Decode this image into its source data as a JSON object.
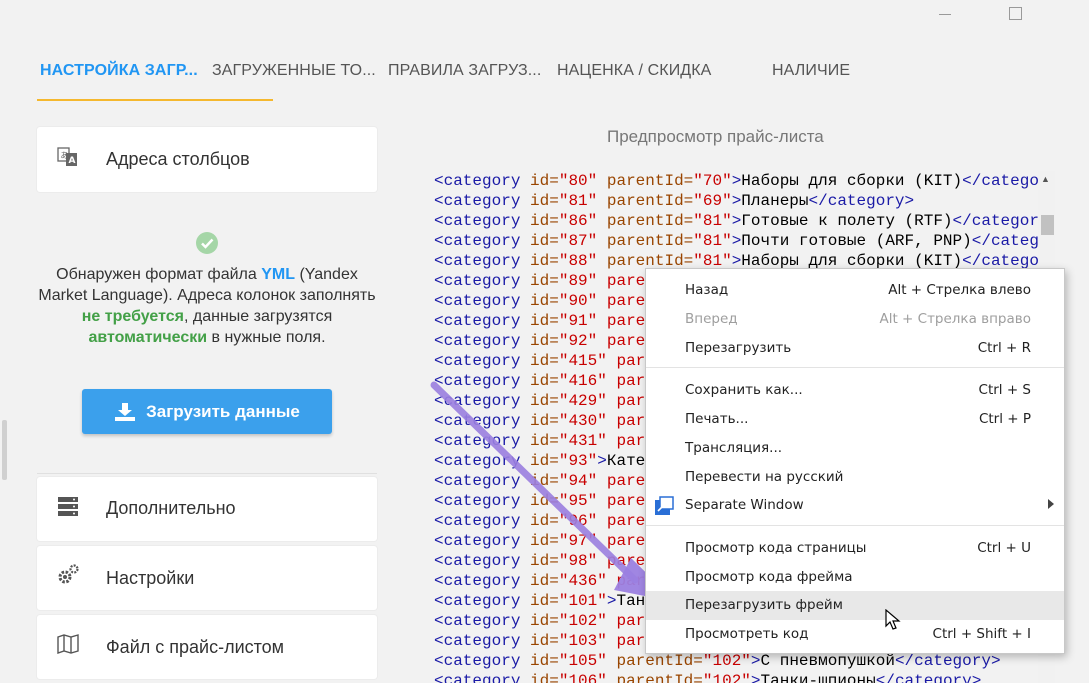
{
  "window": {
    "minimize_icon": "minimize-icon",
    "maximize_icon": "maximize-icon"
  },
  "tabs": [
    {
      "label": "НАСТРОЙКА ЗАГР...",
      "active": true
    },
    {
      "label": "ЗАГРУЖЕННЫЕ ТО..."
    },
    {
      "label": "ПРАВИЛА ЗАГРУЗ..."
    },
    {
      "label": "НАЦЕНКА / СКИДКА"
    },
    {
      "label": "НАЛИЧИЕ"
    }
  ],
  "sidebar": {
    "column_addresses": "Адреса столбцов",
    "info": {
      "p1": "Обнаружен формат файла ",
      "yml": "YML",
      "p2": " (Yandex Market Language). Адреса колонок заполнять ",
      "not_required": "не требуется",
      "p3": ", данные загрузятся ",
      "auto": "автоматически",
      "p4": " в нужные поля."
    },
    "upload_button": "Загрузить данные",
    "additional": "Дополнительно",
    "settings": "Настройки",
    "price_file": "Файл с прайс-листом"
  },
  "preview": {
    "title": "Предпросмотр прайс-листа",
    "lines": [
      {
        "id": "80",
        "parent": "70",
        "text": "Наборы для сборки (KIT)",
        "close": "</catego"
      },
      {
        "id": "81",
        "parent": "69",
        "text": "Планеры",
        "close": "</category>"
      },
      {
        "id": "86",
        "parent": "81",
        "text": "Готовые к полету (RTF)",
        "close": "</categor"
      },
      {
        "id": "87",
        "parent": "81",
        "text": "Почти готовые (ARF, PNP)",
        "close": "</categ"
      },
      {
        "id": "88",
        "parent": "81",
        "text": "Наборы для сборки (KIT)",
        "close": "</catego"
      },
      {
        "id": "89",
        "partial": "pare"
      },
      {
        "id": "90",
        "partial": "pare"
      },
      {
        "id": "91",
        "partial": "pare"
      },
      {
        "id": "92",
        "partial": "pare"
      },
      {
        "id": "415",
        "partial": "par"
      },
      {
        "id": "416",
        "partial": "par"
      },
      {
        "id": "429",
        "partial": "par"
      },
      {
        "id": "430",
        "partial": "par"
      },
      {
        "id": "431",
        "partial": "par"
      },
      {
        "id": "93",
        "plain": "Кате"
      },
      {
        "id": "94",
        "partial": "pare"
      },
      {
        "id": "95",
        "partial": "pare"
      },
      {
        "id": "96",
        "partial": "pare"
      },
      {
        "id": "97",
        "partial": "pare"
      },
      {
        "id": "98",
        "partial": "pare"
      },
      {
        "id": "436",
        "partial": "par"
      },
      {
        "id": "101",
        "plain": "Тан"
      },
      {
        "id": "102",
        "partial": "par"
      },
      {
        "id": "103",
        "partial": "par"
      },
      {
        "id": "105",
        "parent": "102",
        "text": "С пневмопушкой",
        "close": "</category>"
      },
      {
        "id": "106",
        "parent": "102",
        "text": "Танки-шпионы",
        "close": "</category>"
      }
    ]
  },
  "context_menu": {
    "items": [
      {
        "label": "Назад",
        "shortcut": "Alt + Стрелка влево"
      },
      {
        "label": "Вперед",
        "shortcut": "Alt + Стрелка вправо",
        "disabled": true
      },
      {
        "label": "Перезагрузить",
        "shortcut": "Ctrl + R"
      },
      {
        "label": "Сохранить как...",
        "shortcut": "Ctrl + S"
      },
      {
        "label": "Печать...",
        "shortcut": "Ctrl + P"
      },
      {
        "label": "Трансляция...",
        "shortcut": ""
      },
      {
        "label": "Перевести на русский",
        "shortcut": ""
      },
      {
        "label": "Separate Window",
        "shortcut": "",
        "submenu": true
      },
      {
        "label": "Просмотр кода страницы",
        "shortcut": "Ctrl + U"
      },
      {
        "label": "Просмотр кода фрейма",
        "shortcut": ""
      },
      {
        "label": "Перезагрузить фрейм",
        "shortcut": "",
        "hover": true
      },
      {
        "label": "Просмотреть код",
        "shortcut": "Ctrl + Shift + I"
      }
    ]
  },
  "colors": {
    "accent": "#2196f3",
    "tab_underline": "#f5b82e",
    "green": "#43a047",
    "arrow": "#9b7fe0"
  }
}
